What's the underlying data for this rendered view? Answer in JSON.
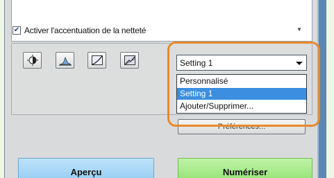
{
  "checkbox": {
    "checked": true,
    "label": "Activer l'accentuation de la netteté"
  },
  "toolbar": {
    "icons": [
      "brightness-contrast-icon",
      "histogram-icon",
      "tone-curve-icon",
      "final-review-icon"
    ]
  },
  "dropdown": {
    "selected": "Setting 1",
    "options": [
      "Personnalisé",
      "Setting 1",
      "Ajouter/Supprimer..."
    ],
    "highlighted_index": 1
  },
  "buttons": {
    "preferences": "Préférences...",
    "preview": "Aperçu",
    "scan": "Numériser"
  },
  "colors": {
    "highlight_outline": "#e8892a",
    "selection": "#3b8ee0",
    "preview_button": "#8ec9f1",
    "scan_button": "#8ee06c"
  }
}
